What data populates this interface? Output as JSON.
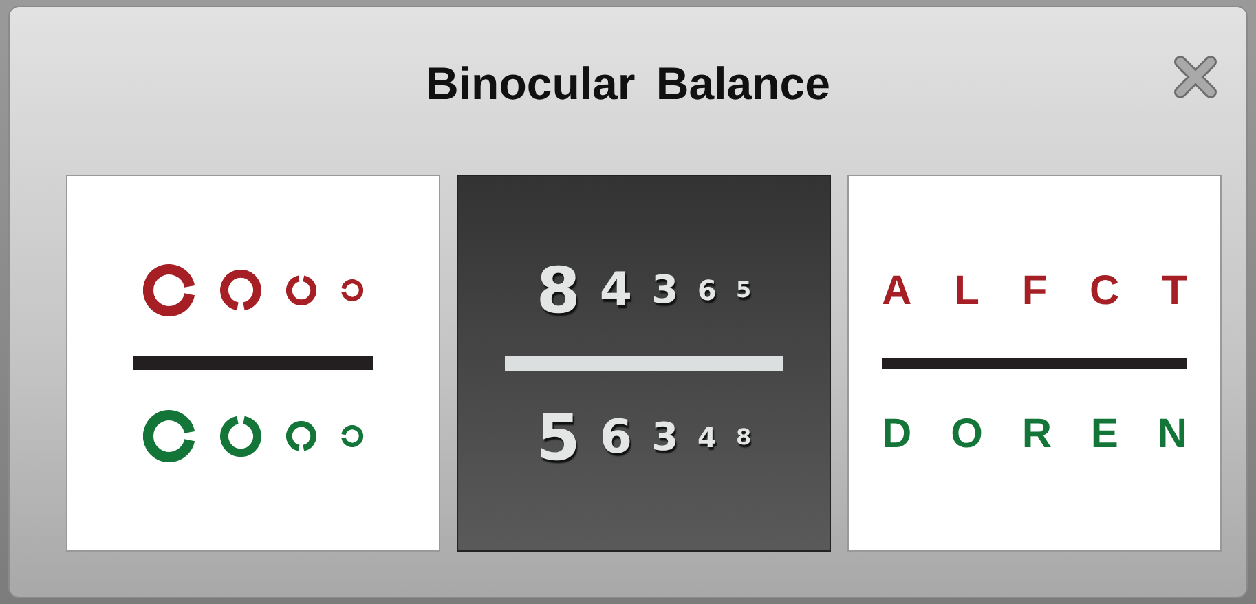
{
  "window": {
    "title": "Binocular Balance"
  },
  "panels": [
    {
      "kind": "rings",
      "rows": [
        {
          "color": "#a51f24",
          "rings": [
            {
              "kind": "right"
            },
            {
              "kind": "down"
            },
            {
              "kind": "up"
            },
            {
              "kind": "left"
            }
          ]
        },
        {
          "color": "#137538",
          "rings": [
            {
              "kind": "right"
            },
            {
              "kind": "up"
            },
            {
              "kind": "down"
            },
            {
              "kind": "left"
            }
          ]
        }
      ]
    },
    {
      "kind": "digits",
      "rows": [
        {
          "chars": [
            "8",
            "4",
            "3",
            "6",
            "5"
          ]
        },
        {
          "chars": [
            "5",
            "6",
            "3",
            "4",
            "8"
          ]
        }
      ]
    },
    {
      "kind": "letters",
      "rows": [
        {
          "color": "#a51f24",
          "chars": [
            "A",
            "L",
            "F",
            "C",
            "T"
          ]
        },
        {
          "color": "#137538",
          "chars": [
            "D",
            "O",
            "R",
            "E",
            "N"
          ]
        }
      ]
    }
  ]
}
